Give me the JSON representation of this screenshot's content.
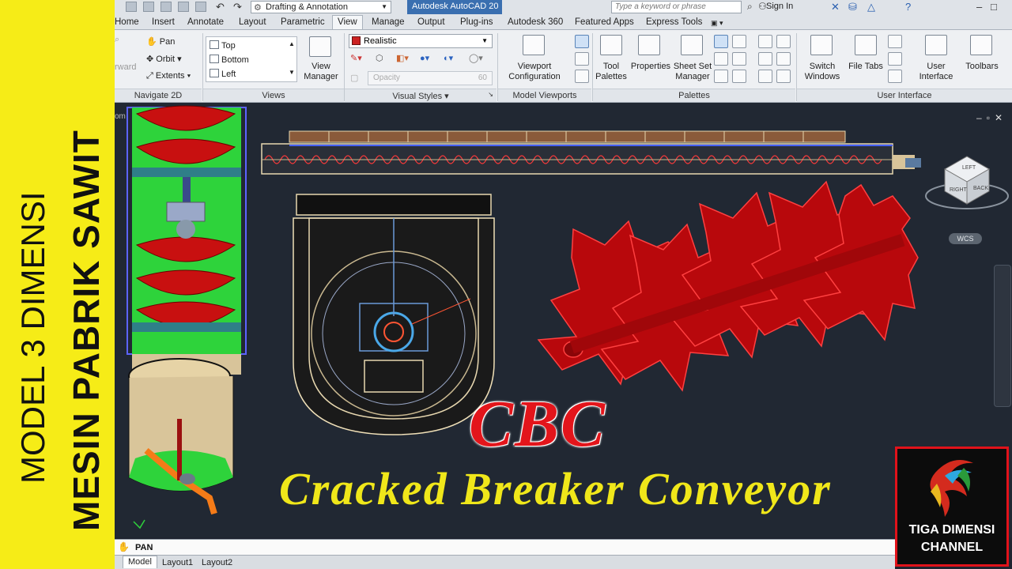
{
  "banner": {
    "line1": "MODEL 3 DIMENSI",
    "line2": "MESIN PABRIK SAWIT"
  },
  "titlebar": {
    "workspace": "Drafting & Annotation",
    "app_title": "Autodesk AutoCAD 20",
    "search_placeholder": "Type a keyword or phrase",
    "sign_in": "Sign In"
  },
  "ribbon_tabs": [
    "Home",
    "Insert",
    "Annotate",
    "Layout",
    "Parametric",
    "View",
    "Manage",
    "Output",
    "Plug-ins",
    "Autodesk 360",
    "Featured Apps",
    "Express Tools"
  ],
  "active_tab": "View",
  "ribbon": {
    "navigate": {
      "forward_label": "rward",
      "pan": "Pan",
      "orbit": "Orbit",
      "extents": "Extents",
      "title": "Navigate 2D"
    },
    "views": {
      "items": [
        "Top",
        "Bottom",
        "Left"
      ],
      "view_manager": "View\nManager",
      "title": "Views"
    },
    "visual_styles": {
      "selected": "Realistic",
      "opacity_label": "Opacity",
      "opacity_value": "60",
      "title": "Visual Styles"
    },
    "model_viewports": {
      "viewport_config": "Viewport\nConfiguration",
      "title": "Model Viewports"
    },
    "palettes": {
      "tool_palettes": "Tool\nPalettes",
      "properties": "Properties",
      "sheet_set": "Sheet Set\nManager",
      "title": "Palettes"
    },
    "user_interface": {
      "switch_windows": "Switch\nWindows",
      "file_tabs": "File Tabs",
      "user_interface": "User\nInterface",
      "toolbars": "Toolbars",
      "title": "User Interface"
    }
  },
  "viewport": {
    "label": "om",
    "wcs": "WCS",
    "viewcube_faces": [
      "RIGHT",
      "BACK",
      "LEFT"
    ]
  },
  "overlay": {
    "cbc": "CBC",
    "subtitle": "Cracked Breaker Conveyor"
  },
  "logo": {
    "line1": "TIGA DIMENSI",
    "line2": "CHANNEL"
  },
  "command": {
    "text": "PAN"
  },
  "layout_tabs": [
    "Model",
    "Layout1",
    "Layout2"
  ],
  "colors": {
    "banner": "#f6ec17",
    "canvas": "#212833",
    "cbc_red": "#e3151b",
    "subtitle_yellow": "#f0e71a"
  }
}
